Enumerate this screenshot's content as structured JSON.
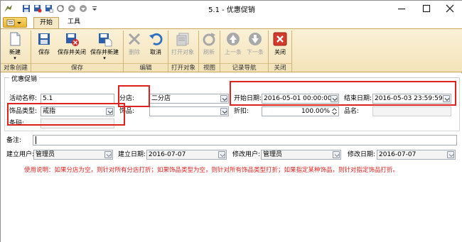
{
  "window": {
    "title": "5.1 - 优惠促销",
    "min_icon": "minimize-icon",
    "max_icon": "maximize-icon",
    "close_icon": "close-icon"
  },
  "tabs": [
    {
      "label": "开始"
    },
    {
      "label": "工具"
    }
  ],
  "ribbon": {
    "buttons": {
      "new": "新建",
      "save": "保存",
      "save_close": "保存并关闭",
      "save_new": "保存并新建",
      "delete": "删除",
      "cancel": "取消",
      "open_obj": "打开对象",
      "refresh": "刷新",
      "prev": "上一条",
      "next": "下一条",
      "close": "关闭"
    },
    "groups": {
      "object_create": "对象创建",
      "save": "保存",
      "edit": "编辑",
      "open_obj": "打开对象",
      "view": "视图",
      "record_nav": "记录导航",
      "close": "关闭"
    }
  },
  "form": {
    "section_title": "优惠促销",
    "labels": {
      "activity_name": "活动名称:",
      "branch": "分店:",
      "start_date": "开始日期:",
      "end_date": "结束日期:",
      "jewelry_type": "饰品类型:",
      "jewelry": "饰品:",
      "discount": "折扣:",
      "product_name": "品名:",
      "barcode": "条码:",
      "remark": "备注:",
      "creator": "建立用户:",
      "create_date": "建立日期:",
      "modifier": "修改用户:",
      "modify_date": "修改日期:"
    },
    "values": {
      "activity_name": "5.1",
      "branch": "二分店",
      "start_date": "2016-05-01 00:00:00",
      "end_date": "2016-05-03 23:59:59",
      "jewelry_type": "戒指",
      "jewelry": "",
      "discount": "100.00%",
      "product_name": "",
      "barcode": "",
      "remark": "",
      "creator": "管理员",
      "create_date": "2016-07-07",
      "modifier": "管理员",
      "modify_date": "2016-07-07"
    },
    "note": "使用说明：如果分店为空，则针对所有分店打折；如果饰品类型为空，则针对所有饰品类型打折；如果指定某种饰品，则针对指定饰品打折。"
  },
  "colors": {
    "accent": "#e0221f",
    "ribbon_bg": "#f3e3b9",
    "tab_active": "#f5e8c6"
  }
}
